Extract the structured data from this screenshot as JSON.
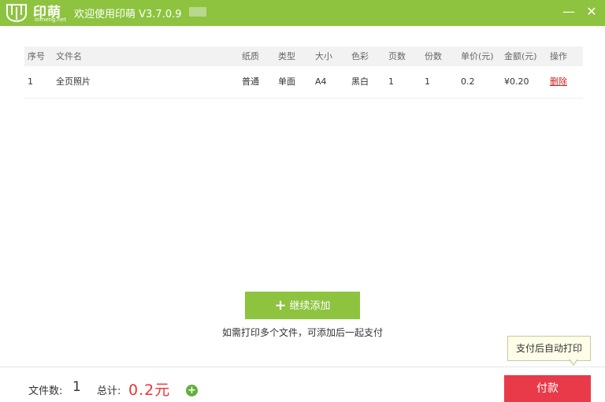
{
  "app": {
    "logo_text": "印萌",
    "logo_sub": "inmeng.net",
    "title": "欢迎使用印萌 V3.7.0.9",
    "minimize_glyph": "—",
    "close_glyph": "✕"
  },
  "table": {
    "headers": [
      "序号",
      "文件名",
      "纸质",
      "类型",
      "大小",
      "色彩",
      "页数",
      "份数",
      "单价(元)",
      "金额(元)",
      "操作"
    ],
    "rows": [
      {
        "index": "1",
        "filename": "全页照片",
        "paper": "普通",
        "type": "单面",
        "size": "A4",
        "color": "黑白",
        "pages": "1",
        "copies": "1",
        "unit_price": "0.2",
        "amount": "¥0.20",
        "action": "删除"
      }
    ]
  },
  "add_button": {
    "plus": "+",
    "label": "继续添加"
  },
  "hint": "如需打印多个文件，可添加后一起支付",
  "footer": {
    "file_count_label": "文件数:",
    "file_count": "1",
    "total_label": "总计:",
    "total_value": "0.2元",
    "plus_glyph": "+",
    "pay_label": "付款"
  },
  "tooltip": "支付后自动打印",
  "colors": {
    "brand_green": "#8dc33f",
    "pay_red": "#e83a48",
    "total_red": "#e33333",
    "delete_red": "#cc2222"
  }
}
